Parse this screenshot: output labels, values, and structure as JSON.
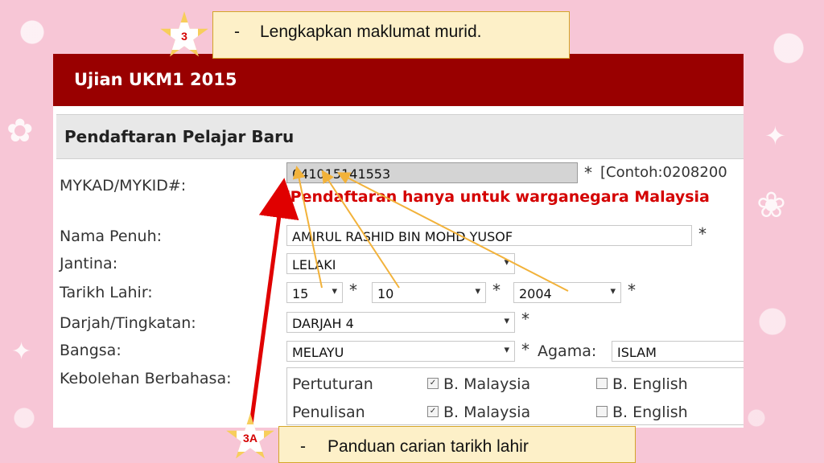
{
  "app": {
    "title": "Ujian UKM1 2015"
  },
  "section": {
    "title": "Pendaftaran Pelajar Baru"
  },
  "form": {
    "mykad": {
      "label": "MYKAD/MYKID#:",
      "value": "041015141553",
      "required": "*",
      "hint": "[Contoh:0208200",
      "warning": "[Pendaftaran hanya untuk warganegara Malaysia"
    },
    "nama": {
      "label": "Nama Penuh:",
      "value": "AMIRUL RASHID BIN MOHD YUSOF",
      "required": "*"
    },
    "jantina": {
      "label": "Jantina:",
      "value": "LELAKI"
    },
    "tarikh": {
      "label": "Tarikh Lahir:",
      "day": "15",
      "month": "10",
      "year": "2004",
      "required": "*"
    },
    "darjah": {
      "label": "Darjah/Tingkatan:",
      "value": "DARJAH 4",
      "required": "*"
    },
    "bangsa": {
      "label": "Bangsa:",
      "value": "MELAYU",
      "required": "*"
    },
    "agama": {
      "label": "Agama:",
      "value": "ISLAM"
    },
    "bahasa": {
      "label": "Kebolehan Berbahasa:",
      "rows": [
        {
          "label": "Pertuturan",
          "malay": "B. Malaysia",
          "malay_checked": true,
          "english": "B. English",
          "english_checked": false
        },
        {
          "label": "Penulisan",
          "malay": "B. Malaysia",
          "malay_checked": true,
          "english": "B. English",
          "english_checked": false
        }
      ]
    }
  },
  "annotations": {
    "step3": {
      "badge": "3",
      "dash": "-",
      "text": "Lengkapkan maklumat murid."
    },
    "step3a": {
      "badge": "3A",
      "dash": "-",
      "text": "Panduan carian tarikh lahir"
    }
  },
  "colors": {
    "header_bg": "#990000",
    "warning": "#d40000",
    "note_bg": "#fdf0c8",
    "badge": "#f7ce5b",
    "arrow_red": "#e00000",
    "arrow_yellow": "#f2b23a"
  }
}
